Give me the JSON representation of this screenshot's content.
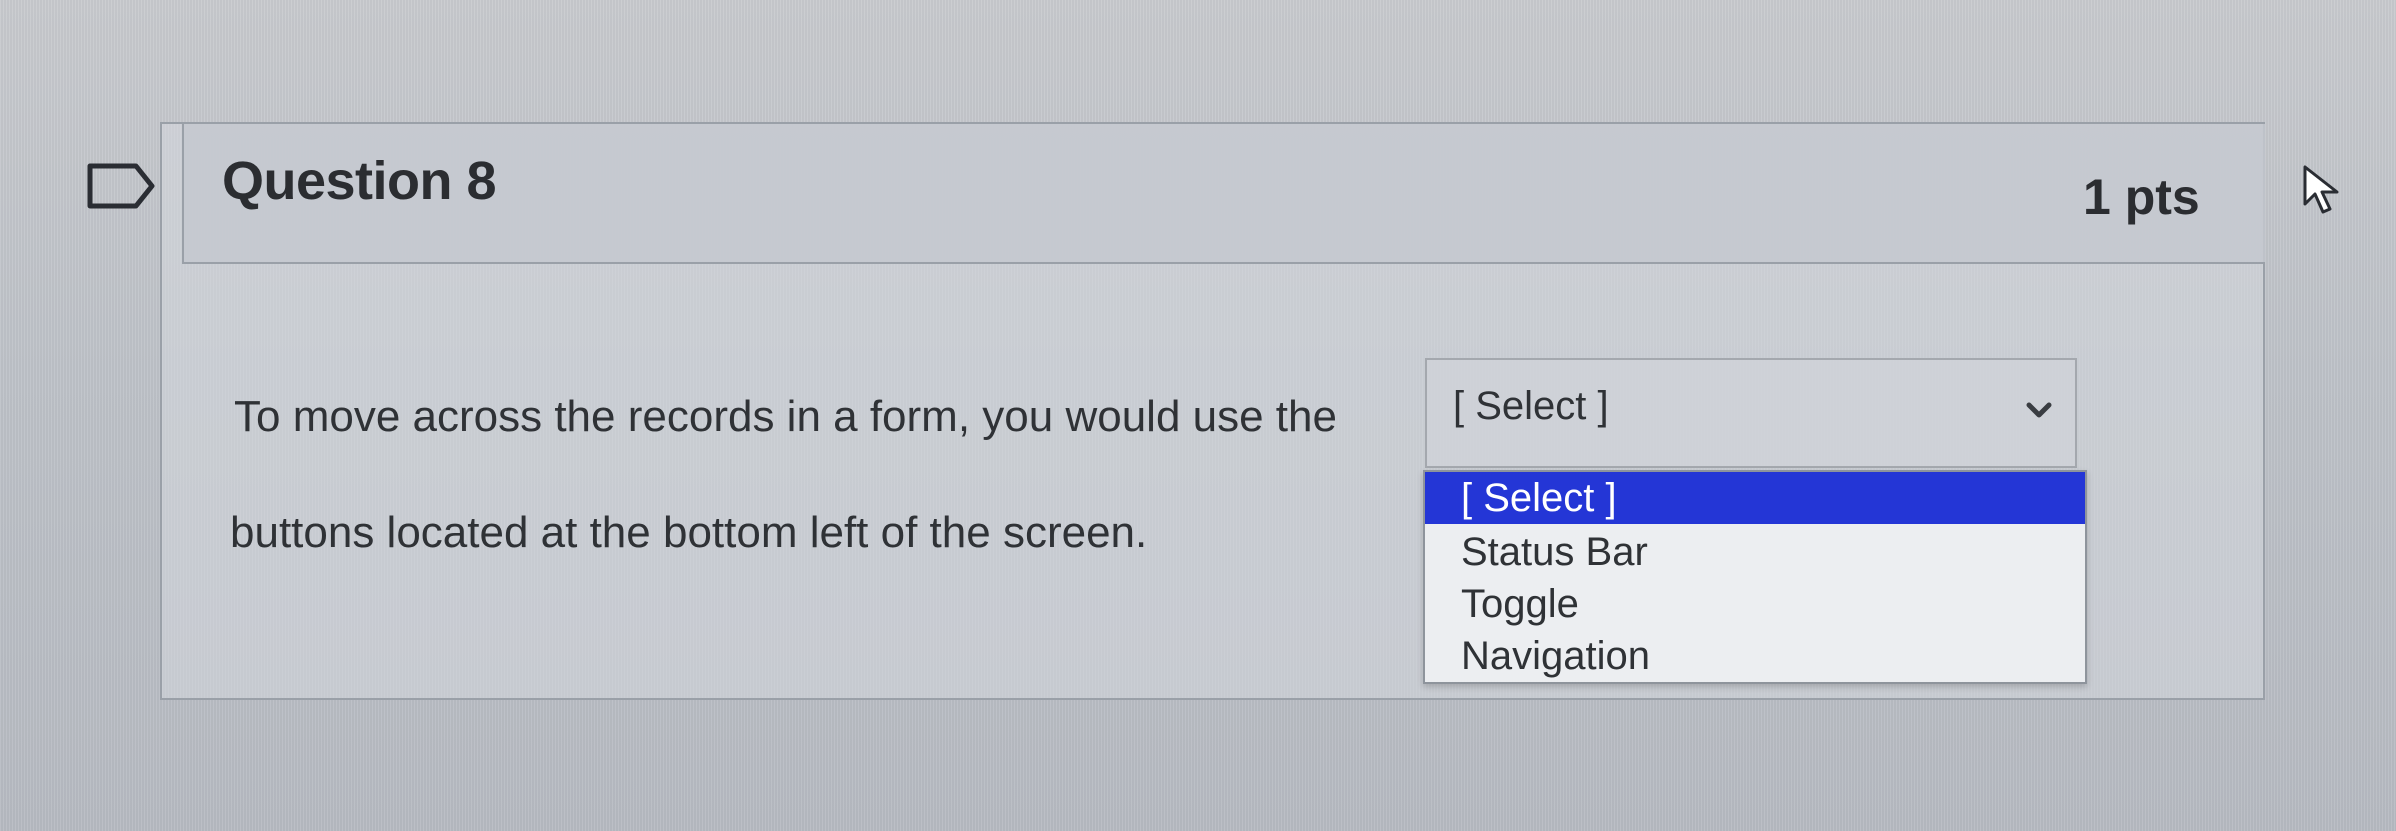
{
  "question": {
    "title": "Question 8",
    "points": "1 pts",
    "prompt_line_1": "To move across the records in a form, you would use the",
    "prompt_line_2": "buttons located at the bottom left of the screen."
  },
  "answer_select": {
    "selected_value": "[ Select ]",
    "options": [
      {
        "label": "[ Select ]",
        "selected": true
      },
      {
        "label": "Status Bar",
        "selected": false
      },
      {
        "label": "Toggle",
        "selected": false
      },
      {
        "label": "Navigation",
        "selected": false
      }
    ]
  },
  "icons": {
    "flag": "flag-icon",
    "chevron": "chevron-down-icon",
    "cursor": "cursor-icon"
  },
  "colors": {
    "selected_option_bg": "#2436d6",
    "selected_option_text": "#ffffff",
    "text": "#2f3236"
  }
}
